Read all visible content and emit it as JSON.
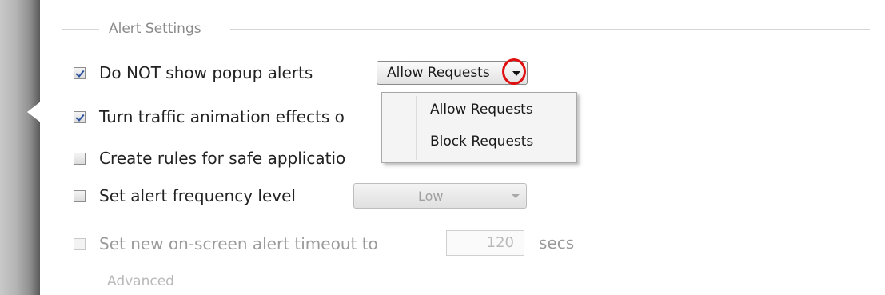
{
  "section_title": "Alert Settings",
  "options": [
    {
      "label": "Do NOT show popup alerts",
      "checked": true,
      "enabled": true
    },
    {
      "label": "Turn traffic animation effects o",
      "checked": true,
      "enabled": true
    },
    {
      "label": "Create rules for safe applicatio",
      "checked": false,
      "enabled": true
    },
    {
      "label": "Set alert frequency level",
      "checked": false,
      "enabled": true
    },
    {
      "label": "Set new on-screen alert timeout to",
      "checked": false,
      "enabled": false
    }
  ],
  "popup_dropdown": {
    "value": "Allow Requests",
    "options": [
      "Allow Requests",
      "Block Requests"
    ]
  },
  "frequency_select": {
    "value": "Low"
  },
  "timeout": {
    "value": "120",
    "unit": "secs"
  },
  "advanced_label": "Advanced",
  "colors": {
    "highlight": "#e01010",
    "check": "#2a4f9e"
  }
}
